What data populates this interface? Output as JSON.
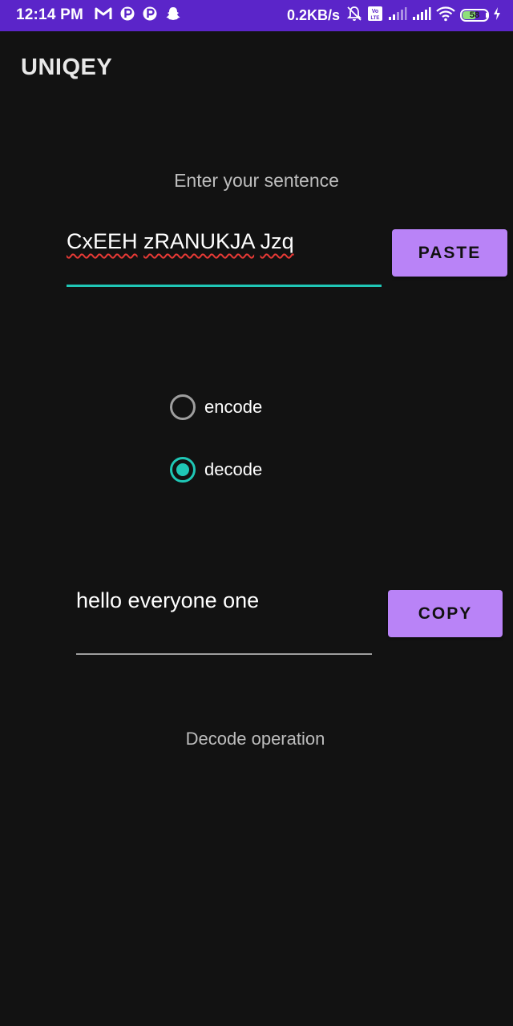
{
  "status_bar": {
    "time": "12:14 PM",
    "net_speed": "0.2KB/s",
    "battery_level": "58",
    "battery_fraction": 0.58,
    "icons": [
      "gmail-icon",
      "p-app-icon",
      "p-app-icon",
      "snapchat-icon",
      "mute-bell-icon",
      "volte-icon",
      "signal-icon",
      "signal-icon",
      "wifi-icon",
      "battery-icon",
      "charging-icon"
    ],
    "color": "#5b25c9"
  },
  "app": {
    "title": "UNIQEY"
  },
  "input": {
    "label": "Enter your sentence",
    "words": [
      "CxEEH",
      "zRANUKJA",
      "Jzq"
    ],
    "accent": "#1fc7b6"
  },
  "buttons": {
    "paste_label": "PASTE",
    "copy_label": "COPY",
    "color": "#b983f7"
  },
  "mode": {
    "options": [
      {
        "label": "encode",
        "checked": false
      },
      {
        "label": "decode",
        "checked": true
      }
    ]
  },
  "output": {
    "value": "hello everyone one"
  },
  "operation_label": "Decode operation"
}
